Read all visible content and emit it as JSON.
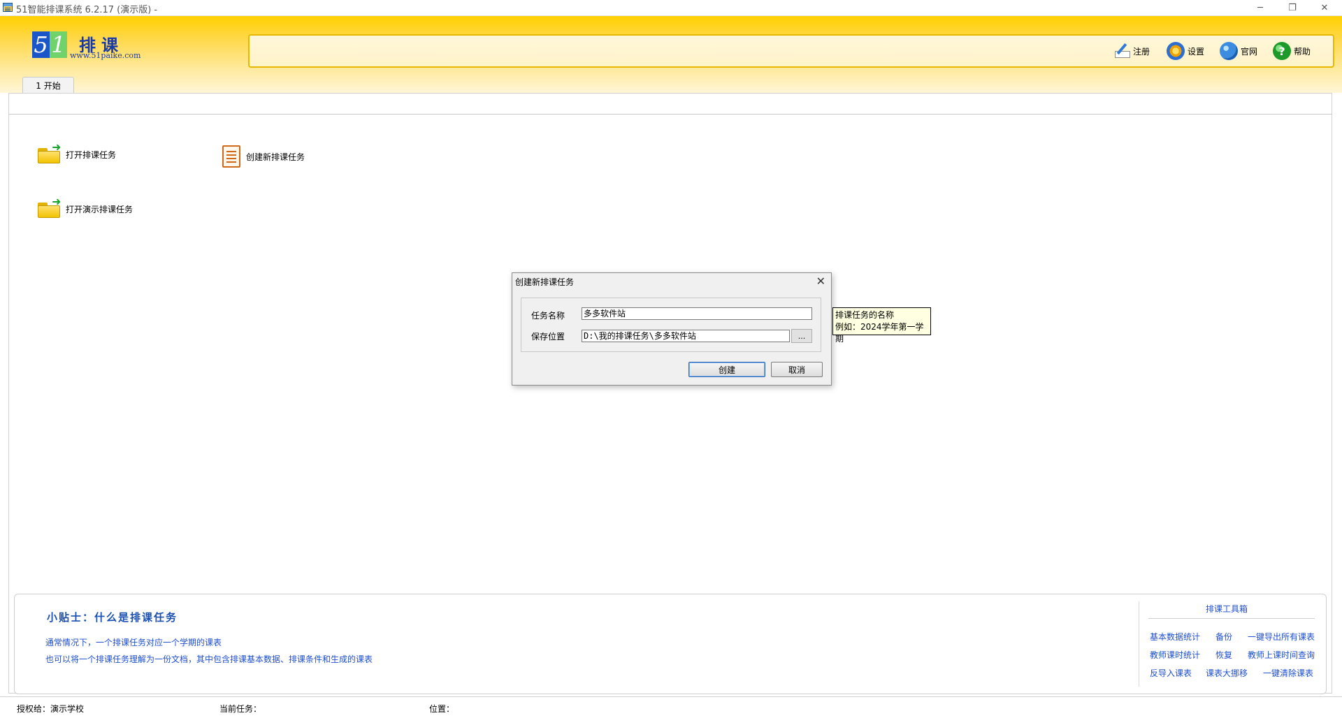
{
  "window": {
    "title": "51智能排课系统 6.2.17 (演示版) -",
    "min": "─",
    "max": "❐",
    "close": "✕"
  },
  "logo": {
    "digit1": "5",
    "digit2": "1",
    "name": "排课",
    "url": "www.51paike.com"
  },
  "toolbar": {
    "register": "注册",
    "settings": "设置",
    "website": "官网",
    "help": "帮助",
    "help_glyph": "?"
  },
  "tabs": [
    {
      "label": "1 开始"
    }
  ],
  "actions": {
    "open_task": "打开排课任务",
    "create_task": "创建新排课任务",
    "open_demo": "打开演示排课任务"
  },
  "dialog": {
    "title": "创建新排课任务",
    "close": "✕",
    "name_label": "任务名称",
    "name_value": "多多软件站",
    "location_label": "保存位置",
    "location_value": "D:\\我的排课任务\\多多软件站",
    "browse": "...",
    "create_button": "创建",
    "cancel_button": "取消"
  },
  "tooltip": {
    "line1": "排课任务的名称",
    "line2": "例如：2024学年第一学期"
  },
  "tips": {
    "title": "小贴士：什么是排课任务",
    "line1": "通常情况下，一个排课任务对应一个学期的课表",
    "line2": "也可以将一个排课任务理解为一份文档，其中包含排课基本数据、排课条件和生成的课表"
  },
  "toolbox": {
    "title": "排课工具箱",
    "links": [
      "基本数据统计",
      "备份",
      "一键导出所有课表",
      "教师课时统计",
      "恢复",
      "教师上课时间查询",
      "反导入课表",
      "课表大挪移",
      "一键清除课表"
    ]
  },
  "status": {
    "licensed": "授权给：演示学校",
    "current_task": "当前任务：",
    "location": "位置："
  }
}
